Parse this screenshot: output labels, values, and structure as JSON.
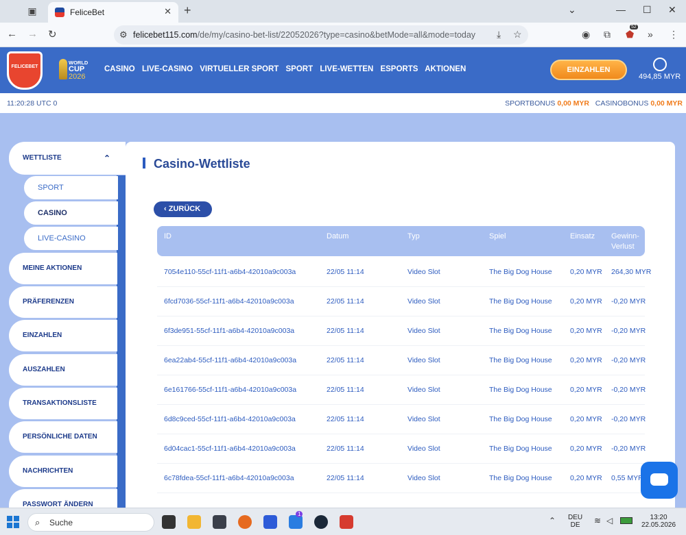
{
  "browser": {
    "tab_title": "FeliceBet",
    "url_domain": "felicebet115.com",
    "url_path": "/de/my/casino-bet-list/22052026?type=casino&betMode=all&mode=today",
    "extension_badge": "52"
  },
  "header": {
    "logo_text": "FELICEBET",
    "worldcup_line1": "WORLD",
    "worldcup_line2": "CUP",
    "worldcup_line3": "2026",
    "nav": [
      "CASINO",
      "LIVE-CASINO",
      "VIRTUELLER SPORT",
      "SPORT",
      "LIVE-WETTEN",
      "ESPORTS",
      "AKTIONEN"
    ],
    "deposit_label": "EINZAHLEN",
    "balance": "494,85 MYR"
  },
  "infobar": {
    "time": "11:20:28 UTC 0",
    "sportbonus_label": "SPORTBONUS",
    "sportbonus_value": "0,00 MYR",
    "casinobonus_label": "CASINOBONUS",
    "casinobonus_value": "0,00 MYR"
  },
  "sidebar": {
    "open_item": "WETTLISTE",
    "sub_items": [
      "SPORT",
      "CASINO",
      "LIVE-CASINO"
    ],
    "items": [
      "MEINE AKTIONEN",
      "PRÄFERENZEN",
      "EINZAHLEN",
      "AUSZAHLEN",
      "TRANSAKTIONSLISTE",
      "PERSÖNLICHE DATEN",
      "NACHRICHTEN",
      "PASSWORT ÄNDERN"
    ]
  },
  "main": {
    "title": "Casino-Wettliste",
    "back_label": "ZURÜCK",
    "columns": [
      "ID",
      "Datum",
      "Typ",
      "Spiel",
      "Einsatz",
      "Gewinn-",
      "Verlust"
    ],
    "rows": [
      {
        "id": "7054e110-55cf-11f1-a6b4-42010a9c003a",
        "date": "22/05 11:14",
        "type": "Video Slot",
        "game": "The Big Dog House",
        "stake": "0,20 MYR",
        "result": "264,30 MYR"
      },
      {
        "id": "6fcd7036-55cf-11f1-a6b4-42010a9c003a",
        "date": "22/05 11:14",
        "type": "Video Slot",
        "game": "The Big Dog House",
        "stake": "0,20 MYR",
        "result": "-0,20 MYR"
      },
      {
        "id": "6f3de951-55cf-11f1-a6b4-42010a9c003a",
        "date": "22/05 11:14",
        "type": "Video Slot",
        "game": "The Big Dog House",
        "stake": "0,20 MYR",
        "result": "-0,20 MYR"
      },
      {
        "id": "6ea22ab4-55cf-11f1-a6b4-42010a9c003a",
        "date": "22/05 11:14",
        "type": "Video Slot",
        "game": "The Big Dog House",
        "stake": "0,20 MYR",
        "result": "-0,20 MYR"
      },
      {
        "id": "6e161766-55cf-11f1-a6b4-42010a9c003a",
        "date": "22/05 11:14",
        "type": "Video Slot",
        "game": "The Big Dog House",
        "stake": "0,20 MYR",
        "result": "-0,20 MYR"
      },
      {
        "id": "6d8c9ced-55cf-11f1-a6b4-42010a9c003a",
        "date": "22/05 11:14",
        "type": "Video Slot",
        "game": "The Big Dog House",
        "stake": "0,20 MYR",
        "result": "-0,20 MYR"
      },
      {
        "id": "6d04cac1-55cf-11f1-a6b4-42010a9c003a",
        "date": "22/05 11:14",
        "type": "Video Slot",
        "game": "The Big Dog House",
        "stake": "0,20 MYR",
        "result": "-0,20 MYR"
      },
      {
        "id": "6c78fdea-55cf-11f1-a6b4-42010a9c003a",
        "date": "22/05 11:14",
        "type": "Video Slot",
        "game": "The Big Dog House",
        "stake": "0,20 MYR",
        "result": "0,55 MYR"
      }
    ]
  },
  "taskbar": {
    "search_placeholder": "Suche",
    "lang_line1": "DEU",
    "lang_line2": "DE",
    "clock_time": "13:20",
    "clock_date": "22.05.2026",
    "notification_badge": "1"
  }
}
